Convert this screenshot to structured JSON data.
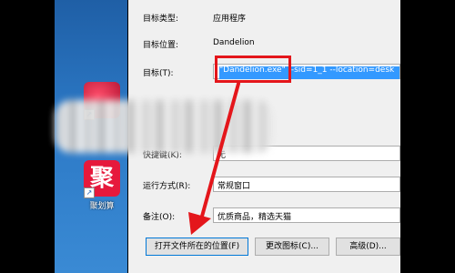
{
  "dialog": {
    "rows": [
      {
        "label": "目标类型:",
        "value": "应用程序"
      },
      {
        "label": "目标位置:",
        "value": "Dandelion"
      },
      {
        "label": "目标(T):",
        "value": "\"Dandelion.exe\" --sid=1_1 --location=desk"
      }
    ],
    "shortcut_label": "快捷键(K):",
    "shortcut_value": "无",
    "run_label": "运行方式(R):",
    "run_value": "常规窗口",
    "comment_label": "备注(O):",
    "comment_value": "优质商品，精选天猫",
    "buttons": {
      "open_location": "打开文件所在的位置(F)",
      "change_icon": "更改图标(C)...",
      "advanced": "高级(D)..."
    }
  },
  "desktop": {
    "icon2_label": "聚划算",
    "icon2_glyph": "聚"
  },
  "colors": {
    "annotation": "#e4161b",
    "selection": "#3399ff"
  }
}
